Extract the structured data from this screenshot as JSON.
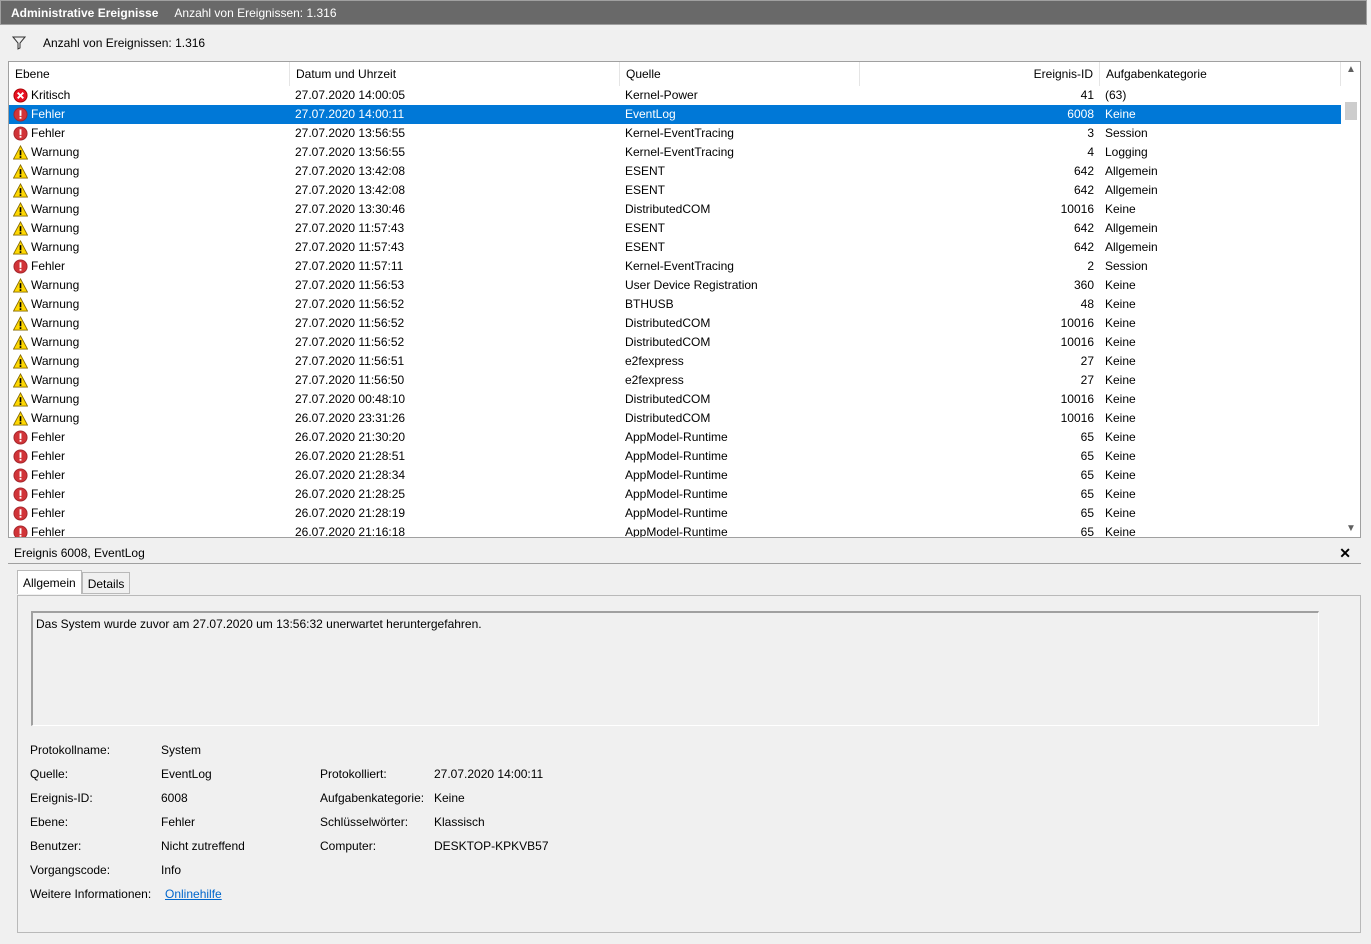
{
  "titlebar": {
    "title": "Administrative Ereignisse",
    "count": "Anzahl von Ereignissen: 1.316"
  },
  "filterbar": {
    "icon": "filter-icon",
    "text": "Anzahl von Ereignissen: 1.316"
  },
  "columns": {
    "level": "Ebene",
    "datetime": "Datum und Uhrzeit",
    "source": "Quelle",
    "event_id": "Ereignis-ID",
    "task_category": "Aufgabenkategorie"
  },
  "events": [
    {
      "level": "Kritisch",
      "icon": "critical",
      "datetime": "27.07.2020 14:00:05",
      "source": "Kernel-Power",
      "id": "41",
      "category": "(63)"
    },
    {
      "level": "Fehler",
      "icon": "error",
      "datetime": "27.07.2020 14:00:11",
      "source": "EventLog",
      "id": "6008",
      "category": "Keine",
      "selected": true
    },
    {
      "level": "Fehler",
      "icon": "error",
      "datetime": "27.07.2020 13:56:55",
      "source": "Kernel-EventTracing",
      "id": "3",
      "category": "Session"
    },
    {
      "level": "Warnung",
      "icon": "warning",
      "datetime": "27.07.2020 13:56:55",
      "source": "Kernel-EventTracing",
      "id": "4",
      "category": "Logging"
    },
    {
      "level": "Warnung",
      "icon": "warning",
      "datetime": "27.07.2020 13:42:08",
      "source": "ESENT",
      "id": "642",
      "category": "Allgemein"
    },
    {
      "level": "Warnung",
      "icon": "warning",
      "datetime": "27.07.2020 13:42:08",
      "source": "ESENT",
      "id": "642",
      "category": "Allgemein"
    },
    {
      "level": "Warnung",
      "icon": "warning",
      "datetime": "27.07.2020 13:30:46",
      "source": "DistributedCOM",
      "id": "10016",
      "category": "Keine"
    },
    {
      "level": "Warnung",
      "icon": "warning",
      "datetime": "27.07.2020 11:57:43",
      "source": "ESENT",
      "id": "642",
      "category": "Allgemein"
    },
    {
      "level": "Warnung",
      "icon": "warning",
      "datetime": "27.07.2020 11:57:43",
      "source": "ESENT",
      "id": "642",
      "category": "Allgemein"
    },
    {
      "level": "Fehler",
      "icon": "error",
      "datetime": "27.07.2020 11:57:11",
      "source": "Kernel-EventTracing",
      "id": "2",
      "category": "Session"
    },
    {
      "level": "Warnung",
      "icon": "warning",
      "datetime": "27.07.2020 11:56:53",
      "source": "User Device Registration",
      "id": "360",
      "category": "Keine"
    },
    {
      "level": "Warnung",
      "icon": "warning",
      "datetime": "27.07.2020 11:56:52",
      "source": "BTHUSB",
      "id": "48",
      "category": "Keine"
    },
    {
      "level": "Warnung",
      "icon": "warning",
      "datetime": "27.07.2020 11:56:52",
      "source": "DistributedCOM",
      "id": "10016",
      "category": "Keine"
    },
    {
      "level": "Warnung",
      "icon": "warning",
      "datetime": "27.07.2020 11:56:52",
      "source": "DistributedCOM",
      "id": "10016",
      "category": "Keine"
    },
    {
      "level": "Warnung",
      "icon": "warning",
      "datetime": "27.07.2020 11:56:51",
      "source": "e2fexpress",
      "id": "27",
      "category": "Keine"
    },
    {
      "level": "Warnung",
      "icon": "warning",
      "datetime": "27.07.2020 11:56:50",
      "source": "e2fexpress",
      "id": "27",
      "category": "Keine"
    },
    {
      "level": "Warnung",
      "icon": "warning",
      "datetime": "27.07.2020 00:48:10",
      "source": "DistributedCOM",
      "id": "10016",
      "category": "Keine"
    },
    {
      "level": "Warnung",
      "icon": "warning",
      "datetime": "26.07.2020 23:31:26",
      "source": "DistributedCOM",
      "id": "10016",
      "category": "Keine"
    },
    {
      "level": "Fehler",
      "icon": "error",
      "datetime": "26.07.2020 21:30:20",
      "source": "AppModel-Runtime",
      "id": "65",
      "category": "Keine"
    },
    {
      "level": "Fehler",
      "icon": "error",
      "datetime": "26.07.2020 21:28:51",
      "source": "AppModel-Runtime",
      "id": "65",
      "category": "Keine"
    },
    {
      "level": "Fehler",
      "icon": "error",
      "datetime": "26.07.2020 21:28:34",
      "source": "AppModel-Runtime",
      "id": "65",
      "category": "Keine"
    },
    {
      "level": "Fehler",
      "icon": "error",
      "datetime": "26.07.2020 21:28:25",
      "source": "AppModel-Runtime",
      "id": "65",
      "category": "Keine"
    },
    {
      "level": "Fehler",
      "icon": "error",
      "datetime": "26.07.2020 21:28:19",
      "source": "AppModel-Runtime",
      "id": "65",
      "category": "Keine"
    },
    {
      "level": "Fehler",
      "icon": "error",
      "datetime": "26.07.2020 21:16:18",
      "source": "AppModel-Runtime",
      "id": "65",
      "category": "Keine"
    }
  ],
  "detail": {
    "header": "Ereignis 6008, EventLog",
    "close_icon": "close-icon",
    "tabs": [
      "Allgemein",
      "Details"
    ],
    "description": "Das System wurde zuvor am 27.07.2020 um 13:56:32 unerwartet heruntergefahren.",
    "labels": {
      "log_name": "Protokollname:",
      "source": "Quelle:",
      "event_id": "Ereignis-ID:",
      "level": "Ebene:",
      "user": "Benutzer:",
      "opcode": "Vorgangscode:",
      "more_info": "Weitere Informationen:",
      "logged": "Protokolliert:",
      "task_category": "Aufgabenkategorie:",
      "keywords": "Schlüsselwörter:",
      "computer": "Computer:"
    },
    "values": {
      "log_name": "System",
      "source": "EventLog",
      "event_id": "6008",
      "level": "Fehler",
      "user": "Nicht zutreffend",
      "opcode": "Info",
      "more_info_link": "Onlinehilfe",
      "logged": "27.07.2020 14:00:11",
      "task_category": "Keine",
      "keywords": "Klassisch",
      "computer": "DESKTOP-KPKVB57"
    }
  },
  "colors": {
    "selection": "#0078d7",
    "titlebar": "#696969",
    "critical": "#e81123",
    "error": "#d13438",
    "warning": "#ffd800",
    "link": "#0066cc"
  }
}
